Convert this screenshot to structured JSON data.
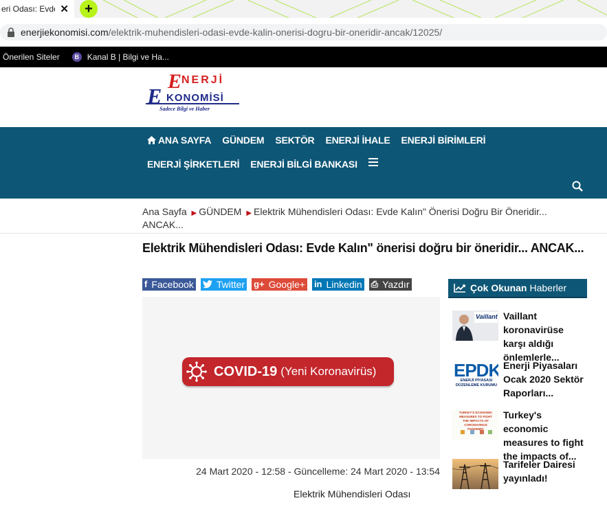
{
  "browser": {
    "tab_title": "eri Odası: Evde",
    "close_glyph": "✕",
    "new_tab_glyph": "+",
    "url_domain": "enerjiekonomisi.com",
    "url_path": "/elektrik-muhendisleri-odasi-evde-kalin-onerisi-dogru-bir-oneridir-ancak/12025/",
    "bookmarks": [
      {
        "label": "Önerilen Siteler"
      },
      {
        "label": "Kanal B | Bilgi ve Ha...",
        "icon_text": "B"
      }
    ]
  },
  "logo": {
    "letter_e_top": "E",
    "letters_nerji": "NERJİ",
    "letter_e_bottom": "E",
    "letters_konomisi": "KONOMİSİ",
    "tagline": "Sadece Bilgi ve Haber"
  },
  "nav": {
    "items": [
      "ANA SAYFA",
      "GÜNDEM",
      "SEKTÖR",
      "ENERJİ İHALE",
      "ENERJİ BİRİMLERİ",
      "ENERJİ ŞİRKETLERİ",
      "ENERJİ BİLGİ BANKASI"
    ]
  },
  "breadcrumb": {
    "home": "Ana Sayfa",
    "section": "GÜNDEM",
    "current": "Elektrik Mühendisleri Odası: Evde Kalın\" Önerisi Doğru Bir Öneridir... ANCAK...",
    "sep": "▶"
  },
  "article": {
    "title": "Elektrik Mühendisleri Odası: Evde Kalın\" önerisi doğru bir öneridir... ANCAK...",
    "date_line": "24 Mart 2020 - 12:58 - Güncelleme: 24 Mart 2020 - 13:54",
    "body_start": "Elektrik Mühendisleri Odası",
    "image_text_bold": "COVID-19",
    "image_text_normal": "(Yeni Koronavirüs)"
  },
  "share": {
    "facebook": {
      "icon": "f",
      "label": "Facebook"
    },
    "twitter": {
      "icon": "t",
      "label": "Twitter"
    },
    "google": {
      "icon": "g+",
      "label": "Google+"
    },
    "linkedin": {
      "icon": "in",
      "label": "Linkedin"
    },
    "print": {
      "icon": "⎙",
      "label": "Yazdır"
    }
  },
  "sidebar": {
    "header_bold": "Çok Okunan",
    "header_normal": "Haberler",
    "items": [
      {
        "title": "Vaillant koronavirüse karşı aldığı önlemlerle...",
        "thumb_text": "Vaillant"
      },
      {
        "title": "Enerji Piyasaları Ocak 2020 Sektör Raporları...",
        "thumb_text": "EPDK",
        "thumb_sub": "ENERJİ PİYASASI DÜZENLEME KURUMU"
      },
      {
        "title": "Turkey's economic measures to fight the impacts of...",
        "thumb_text": "TURKEY'S ECONOMIC MEASURES TO FIGHT THE IMPACTS OF CORONAVIRUS PANDEMIC"
      },
      {
        "title": "Tarifeler Dairesi yayınladı!"
      }
    ]
  },
  "colors": {
    "nav_bg": "#0e5675",
    "accent_red": "#c0101a",
    "new_tab_green": "#b7f21a",
    "logo_red": "#d61f1f",
    "logo_blue": "#1f2a8a"
  }
}
